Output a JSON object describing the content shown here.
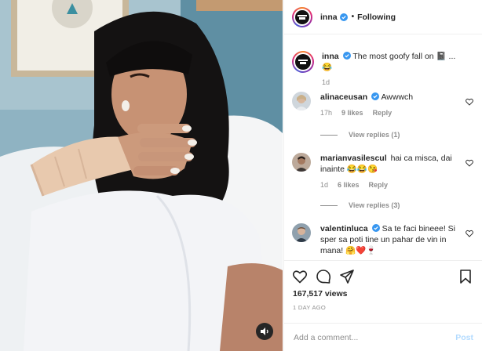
{
  "post": {
    "author": "inna",
    "header_separator": "•",
    "follow_label": "Following",
    "caption": "The most goofy fall on",
    "caption_emoji": "📓 ... 😂",
    "caption_time": "1d",
    "views": "167,517 views",
    "posted_ago": "1 DAY AGO"
  },
  "comments": [
    {
      "username": "alinaceusan",
      "verified": true,
      "text": "Awwwch",
      "time": "17h",
      "likes": "9 likes",
      "reply": "Reply",
      "view_replies": "View replies (1)"
    },
    {
      "username": "marianvasilescul",
      "verified": false,
      "text": "hai ca misca, dai inainte 😂😂😘",
      "time": "1d",
      "likes": "6 likes",
      "reply": "Reply",
      "view_replies": "View replies (3)"
    },
    {
      "username": "valentinluca",
      "verified": true,
      "text": "Sa te faci bineee! Si sper sa poti tine un pahar de vin in mana! 🤗❤️🍷"
    }
  ],
  "add_comment": {
    "placeholder": "Add a comment...",
    "post_label": "Post"
  },
  "icons": {
    "like": "heart-icon",
    "comment": "comment-icon",
    "share": "share-icon",
    "save": "bookmark-icon",
    "mute": "speaker-icon",
    "verified": "verified-badge-icon"
  },
  "colors": {
    "verified": "#3897f0",
    "post_button": "#b3dbff",
    "muted_text": "#8e8e8e",
    "text": "#262626"
  }
}
